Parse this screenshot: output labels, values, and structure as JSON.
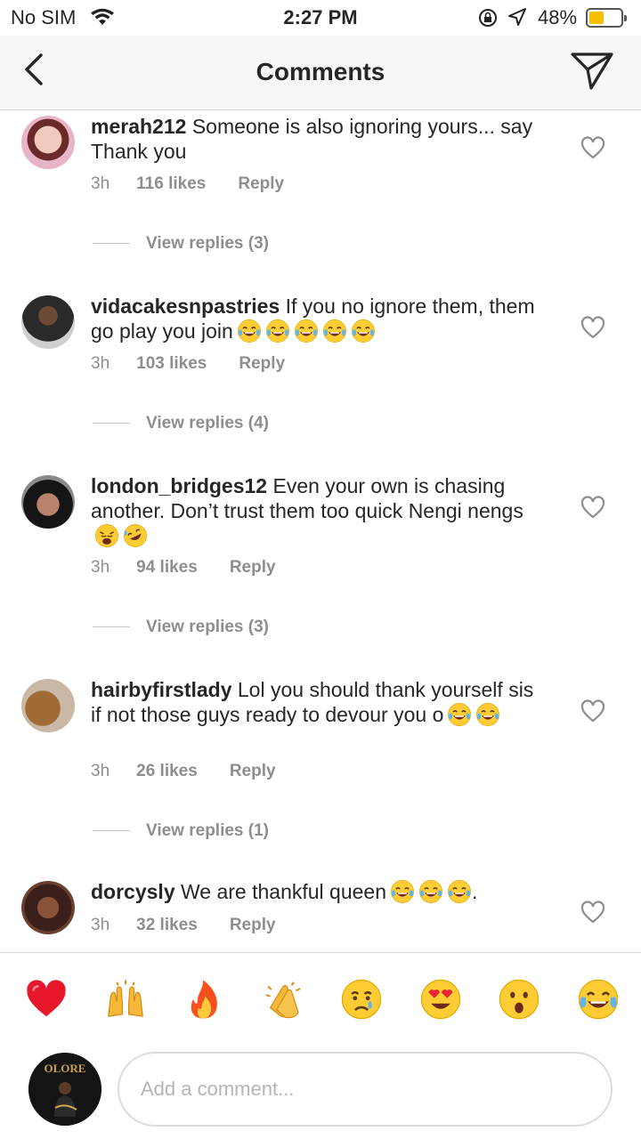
{
  "status_bar": {
    "carrier": "No SIM",
    "time": "2:27 PM",
    "battery_percent": "48%",
    "battery_level": 0.48,
    "battery_color": "#f6c000"
  },
  "nav": {
    "title": "Comments",
    "back_icon": "chevron-left-icon",
    "send_icon": "paper-plane-icon"
  },
  "comments": [
    {
      "username": "merah212",
      "text": "Someone is also ignoring yours... say Thank you",
      "emojis": [],
      "time": "3h",
      "likes": "116 likes",
      "reply": "Reply",
      "view_replies": "View replies (3)"
    },
    {
      "username": "vidacakesnpastries",
      "text": "If you no ignore them, them go play you join",
      "emojis": [
        "tears-of-joy",
        "tears-of-joy",
        "tears-of-joy",
        "tears-of-joy",
        "tears-of-joy"
      ],
      "time": "3h",
      "likes": "103 likes",
      "reply": "Reply",
      "view_replies": "View replies (4)"
    },
    {
      "username": "london_bridges12",
      "text": "Even your own is chasing another. Don’t trust them too quick Nengi nengs",
      "emojis": [
        "weary-face",
        "rolling-laughing"
      ],
      "time": "3h",
      "likes": "94 likes",
      "reply": "Reply",
      "view_replies": "View replies (3)"
    },
    {
      "username": "hairbyfirstlady",
      "text": "Lol you should thank yourself sis if not those guys ready to devour you o",
      "emojis": [
        "tears-of-joy",
        "tears-of-joy"
      ],
      "time": "3h",
      "likes": "26 likes",
      "reply": "Reply",
      "view_replies": "View replies (1)"
    },
    {
      "username": "dorcysly",
      "text": "We are thankful queen",
      "emojis": [
        "tears-of-joy",
        "tears-of-joy",
        "tears-of-joy"
      ],
      "suffix": ".",
      "time": "3h",
      "likes": "32 likes",
      "reply": "Reply"
    }
  ],
  "reactions": [
    "red-heart",
    "raising-hands",
    "fire",
    "clapping-hands",
    "crying-face",
    "heart-eyes",
    "surprised-face",
    "tears-of-joy"
  ],
  "composer": {
    "placeholder": "Add a comment...",
    "avatar_text": "OLORE"
  }
}
